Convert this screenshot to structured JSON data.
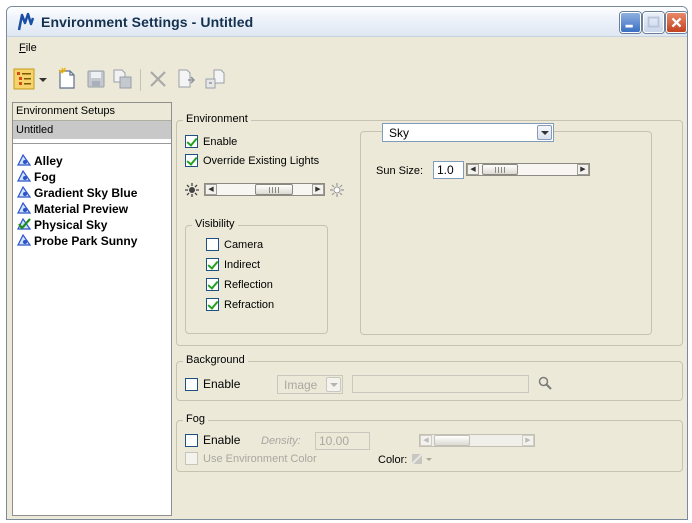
{
  "window": {
    "title": "Environment Settings - Untitled"
  },
  "menu": {
    "file": "File"
  },
  "toolbar": {
    "icons": [
      "tree-view-icon",
      "dropdown-arrow-icon",
      "new-icon",
      "save-icon",
      "save-as-icon",
      "delete-icon",
      "import-icon",
      "export-icon"
    ]
  },
  "sidebar": {
    "header": "Environment Setups",
    "selected": "Untitled",
    "items": [
      {
        "label": "Alley",
        "icon": "environment-icon"
      },
      {
        "label": "Fog",
        "icon": "environment-icon"
      },
      {
        "label": "Gradient Sky Blue",
        "icon": "environment-icon"
      },
      {
        "label": "Material Preview",
        "icon": "environment-icon"
      },
      {
        "label": "Physical Sky",
        "icon": "physical-sky-check-icon"
      },
      {
        "label": "Probe Park Sunny",
        "icon": "environment-icon"
      }
    ]
  },
  "environment": {
    "label": "Environment",
    "enable": {
      "label": "Enable",
      "checked": true
    },
    "override": {
      "label": "Override Existing Lights",
      "checked": true
    },
    "visibility": {
      "label": "Visibility",
      "camera": {
        "label": "Camera",
        "checked": false
      },
      "indirect": {
        "label": "Indirect",
        "checked": true
      },
      "reflection": {
        "label": "Reflection",
        "checked": true
      },
      "refraction": {
        "label": "Refraction",
        "checked": true
      }
    },
    "sky": {
      "type": "Sky",
      "sun_size_label": "Sun Size:",
      "sun_size_value": "1.0"
    }
  },
  "background": {
    "label": "Background",
    "enable": {
      "label": "Enable",
      "checked": false
    },
    "type": "Image"
  },
  "fog": {
    "label": "Fog",
    "enable": {
      "label": "Enable",
      "checked": false
    },
    "density_label": "Density:",
    "density_value": "10.00",
    "use_env_color": {
      "label": "Use Environment Color",
      "checked": false
    },
    "color_label": "Color:"
  },
  "colors": {
    "titlebar": "#dfe7f2",
    "window_bg": "#ece9d8",
    "check_green": "#21a121",
    "selection_gray": "#c8c8c8"
  }
}
